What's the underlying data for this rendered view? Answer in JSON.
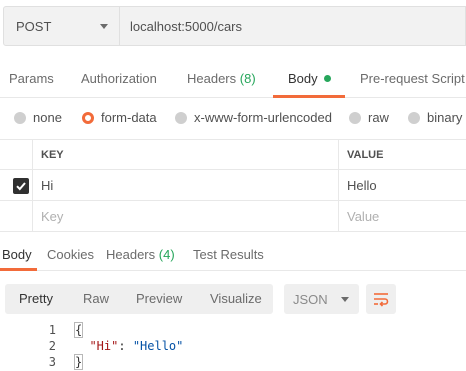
{
  "request": {
    "method": "POST",
    "url": "localhost:5000/cars"
  },
  "request_tabs": [
    {
      "label": "Params"
    },
    {
      "label": "Authorization"
    },
    {
      "label": "Headers",
      "count": "(8)"
    },
    {
      "label": "Body",
      "active": true
    },
    {
      "label": "Pre-request Script"
    }
  ],
  "body_types": [
    {
      "label": "none"
    },
    {
      "label": "form-data",
      "selected": true
    },
    {
      "label": "x-www-form-urlencoded"
    },
    {
      "label": "raw"
    },
    {
      "label": "binary"
    }
  ],
  "kv_table": {
    "headers": {
      "key": "KEY",
      "value": "VALUE"
    },
    "rows": [
      {
        "checked": true,
        "key": "Hi",
        "value": "Hello"
      }
    ],
    "placeholder": {
      "key": "Key",
      "value": "Value"
    }
  },
  "response_tabs": [
    {
      "label": "Body",
      "active": true
    },
    {
      "label": "Cookies"
    },
    {
      "label": "Headers",
      "count": "(4)"
    },
    {
      "label": "Test Results"
    }
  ],
  "response_view": {
    "modes": [
      "Pretty",
      "Raw",
      "Preview",
      "Visualize"
    ],
    "active_mode": "Pretty",
    "format": "JSON"
  },
  "response_body": {
    "line_numbers": [
      "1",
      "2",
      "3"
    ],
    "open_brace": "{",
    "key": "\"Hi\"",
    "colon": ": ",
    "value": "\"Hello\"",
    "close_brace": "}"
  },
  "colors": {
    "accent": "#f26b3a",
    "count_green": "#26a65b"
  },
  "icons": {
    "checkbox": "checkmark-icon",
    "wrap": "wrap-lines-icon"
  }
}
